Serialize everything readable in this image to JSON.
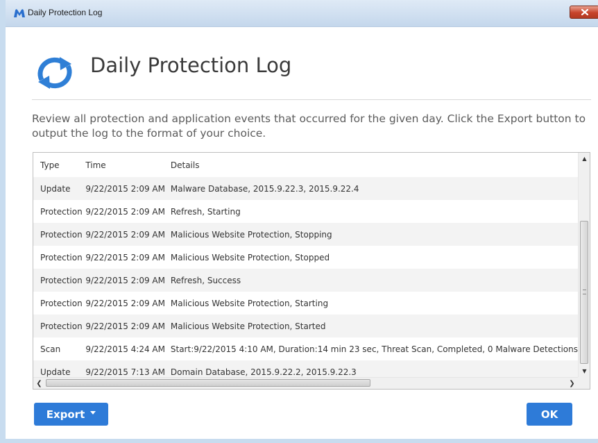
{
  "window": {
    "title": "Daily Protection Log"
  },
  "header": {
    "title": "Daily Protection Log"
  },
  "description": "Review all protection and application events that occurred for the given day. Click the Export button to output the log to the format of your choice.",
  "table": {
    "columns": [
      "Type",
      "Time",
      "Details"
    ],
    "rows": [
      [
        "Update",
        "9/22/2015 2:09 AM",
        "Malware Database, 2015.9.22.3, 2015.9.22.4"
      ],
      [
        "Protection",
        "9/22/2015 2:09 AM",
        "Refresh, Starting"
      ],
      [
        "Protection",
        "9/22/2015 2:09 AM",
        "Malicious Website Protection, Stopping"
      ],
      [
        "Protection",
        "9/22/2015 2:09 AM",
        "Malicious Website Protection, Stopped"
      ],
      [
        "Protection",
        "9/22/2015 2:09 AM",
        "Refresh, Success"
      ],
      [
        "Protection",
        "9/22/2015 2:09 AM",
        "Malicious Website Protection, Starting"
      ],
      [
        "Protection",
        "9/22/2015 2:09 AM",
        "Malicious Website Protection, Started"
      ],
      [
        "Scan",
        "9/22/2015 4:24 AM",
        "Start:9/22/2015 4:10 AM, Duration:14 min 23 sec, Threat Scan, Completed, 0 Malware Detections"
      ],
      [
        "Update",
        "9/22/2015 7:13 AM",
        "Domain Database, 2015.9.22.2, 2015.9.22.3"
      ]
    ]
  },
  "buttons": {
    "export_label": "Export",
    "ok_label": "OK"
  },
  "icons": {
    "app": "malwarebytes-logo-icon",
    "close": "close-icon",
    "header": "refresh-icon"
  },
  "colors": {
    "accent": "#2e7bd8",
    "header_icon": "#2f7fd6",
    "close_button": "#c7442b"
  }
}
